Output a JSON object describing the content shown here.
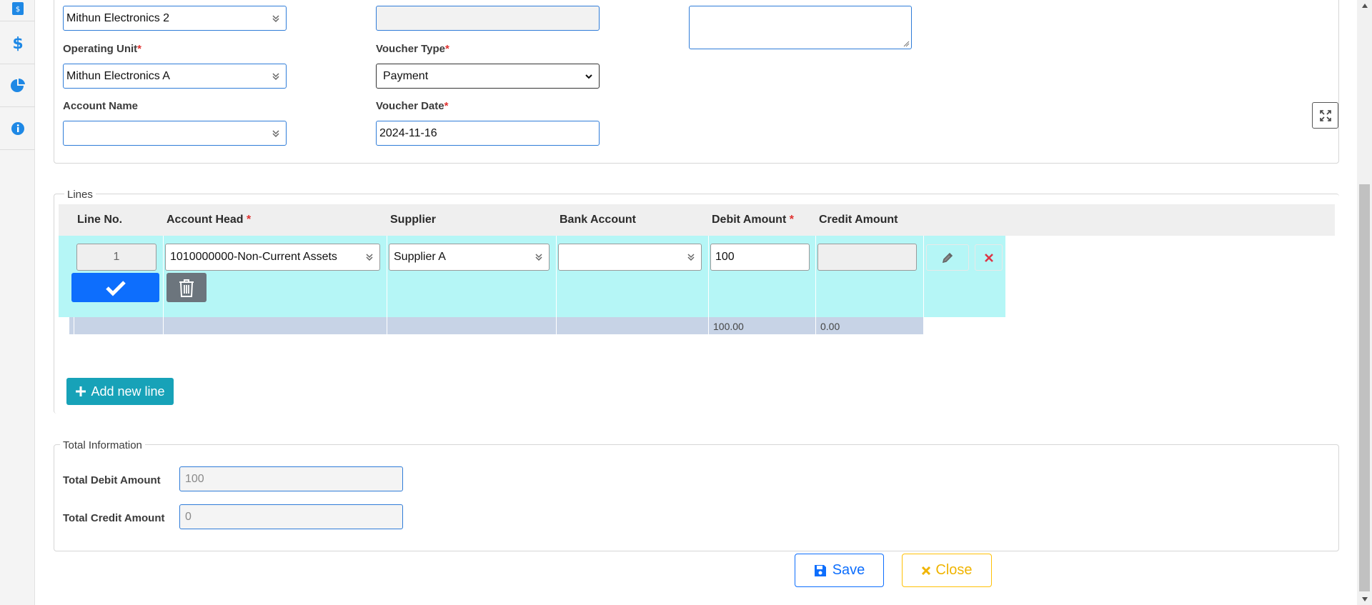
{
  "header_form": {
    "company_value": "Mithun Electronics 2",
    "operating_unit_label": "Operating Unit",
    "operating_unit_value": "Mithun Electronics A",
    "account_name_label": "Account Name",
    "account_name_value": "",
    "blank_field_value": "",
    "voucher_type_label": "Voucher Type",
    "voucher_type_value": "Payment",
    "voucher_date_label": "Voucher Date",
    "voucher_date_value": "2024-11-16",
    "remarks_value": "",
    "required_mark": "*"
  },
  "lines": {
    "legend": "Lines",
    "columns": {
      "line_no": "Line No.",
      "account_head": "Account Head",
      "supplier": "Supplier",
      "bank_account": "Bank Account",
      "debit_amount": "Debit Amount",
      "credit_amount": "Credit Amount"
    },
    "rows": [
      {
        "line_no": "1",
        "account_head": "1010000000-Non-Current Assets",
        "supplier": "Supplier A",
        "bank_account": "",
        "debit_amount": "100",
        "credit_amount": ""
      }
    ],
    "summary": {
      "debit_total": "100.00",
      "credit_total": "0.00"
    },
    "add_button_label": "Add new line"
  },
  "totals": {
    "legend": "Total Information",
    "total_debit_label": "Total Debit Amount",
    "total_debit_value": "100",
    "total_credit_label": "Total Credit Amount",
    "total_credit_value": "0"
  },
  "actions": {
    "save_label": "Save",
    "close_label": "Close"
  },
  "colors": {
    "primary": "#0d6efd",
    "info": "#17a2b8",
    "warning": "#ffc107",
    "danger": "#dc3545",
    "row_highlight": "#b5f6f6",
    "summary_row": "#c7d3e6",
    "sidebar_icon": "#1e88e5"
  },
  "icons": {
    "sidebar": [
      "dollar-doc-icon",
      "dollar-icon",
      "pie-chart-icon",
      "info-icon"
    ],
    "row": [
      "check-icon",
      "trash-icon",
      "pencil-icon",
      "close-x-icon"
    ],
    "expand": "expand-icon",
    "save": "floppy-disk-icon",
    "close": "times-icon",
    "add": "plus-icon"
  }
}
